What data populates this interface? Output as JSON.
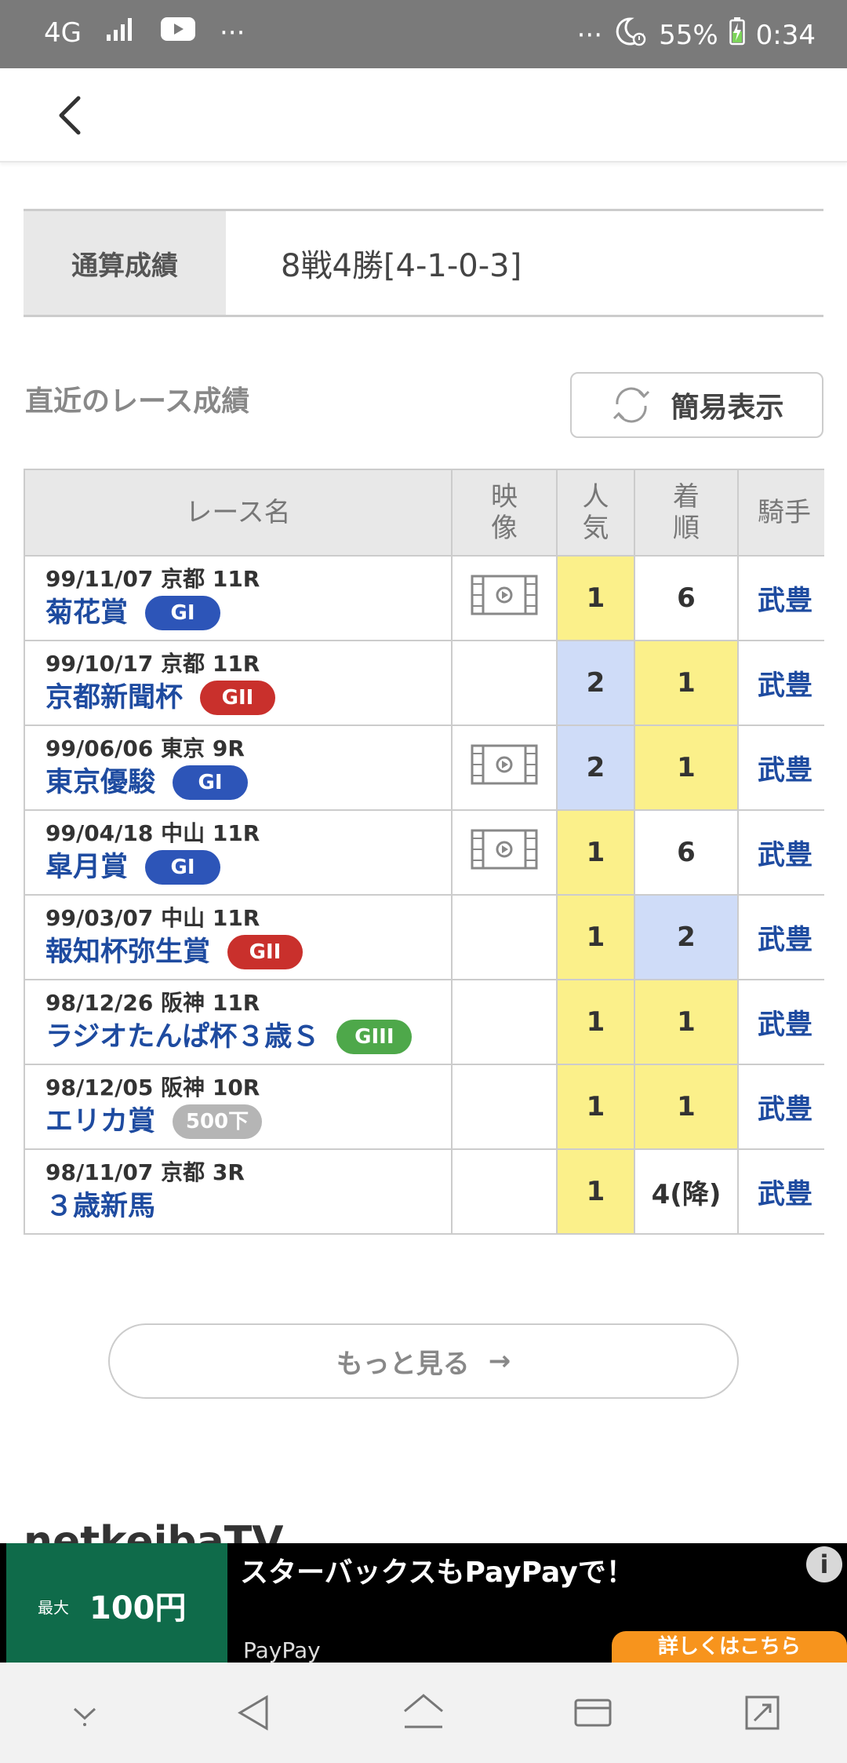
{
  "status_bar": {
    "network": "4G",
    "more_left": "···",
    "more_right": "···",
    "battery": "55%",
    "time": "0:34"
  },
  "summary": {
    "label": "通算成績",
    "value": "8戦4勝[4-1-0-3]"
  },
  "recent": {
    "title": "直近のレース成績",
    "simple_view_label": "簡易表示"
  },
  "table": {
    "headers": {
      "race": "レース名",
      "video_1": "映",
      "video_2": "像",
      "pop_1": "人",
      "pop_2": "気",
      "finish_1": "着",
      "finish_2": "順",
      "jockey": "騎手"
    },
    "rows": [
      {
        "meta": "99/11/07 京都 11R",
        "name": "菊花賞",
        "grade": "GI",
        "video": true,
        "popularity": "1",
        "finish": "6",
        "jockey": "武豊"
      },
      {
        "meta": "99/10/17 京都 11R",
        "name": "京都新聞杯",
        "grade": "GII",
        "video": false,
        "popularity": "2",
        "finish": "1",
        "jockey": "武豊"
      },
      {
        "meta": "99/06/06 東京 9R",
        "name": "東京優駿",
        "grade": "GI",
        "video": true,
        "popularity": "2",
        "finish": "1",
        "jockey": "武豊"
      },
      {
        "meta": "99/04/18 中山 11R",
        "name": "皐月賞",
        "grade": "GI",
        "video": true,
        "popularity": "1",
        "finish": "6",
        "jockey": "武豊"
      },
      {
        "meta": "99/03/07 中山 11R",
        "name": "報知杯弥生賞",
        "grade": "GII",
        "video": false,
        "popularity": "1",
        "finish": "2",
        "jockey": "武豊"
      },
      {
        "meta": "98/12/26 阪神 11R",
        "name": "ラジオたんぱ杯３歳Ｓ",
        "grade": "GIII",
        "video": false,
        "popularity": "1",
        "finish": "1",
        "jockey": "武豊"
      },
      {
        "meta": "98/12/05 阪神 10R",
        "name": "エリカ賞",
        "grade": "500下",
        "video": false,
        "popularity": "1",
        "finish": "1",
        "jockey": "武豊"
      },
      {
        "meta": "98/11/07 京都 3R",
        "name": "３歳新馬",
        "grade": "",
        "video": false,
        "popularity": "1",
        "finish": "4(降)",
        "jockey": "武豊"
      }
    ]
  },
  "more_button": {
    "label": "もっと見る",
    "arrow": "→"
  },
  "netkeiba_tv_peek": "netkeibaTV",
  "ad": {
    "headline": "スターバックスもPayPayで！",
    "sponsor": "PayPay",
    "cta": "詳しくはこちら",
    "info": "i",
    "thumb_small": "最大",
    "thumb_big": "100円"
  },
  "colors": {
    "link_blue": "#1e4ba0",
    "grade_gi": "#2d55b8",
    "grade_gii": "#c9302c",
    "grade_giii": "#4ea84a",
    "grade_cond": "#b5b5b5",
    "highlight_yellow": "#fbf08a",
    "highlight_blue": "#cfdcf8"
  }
}
